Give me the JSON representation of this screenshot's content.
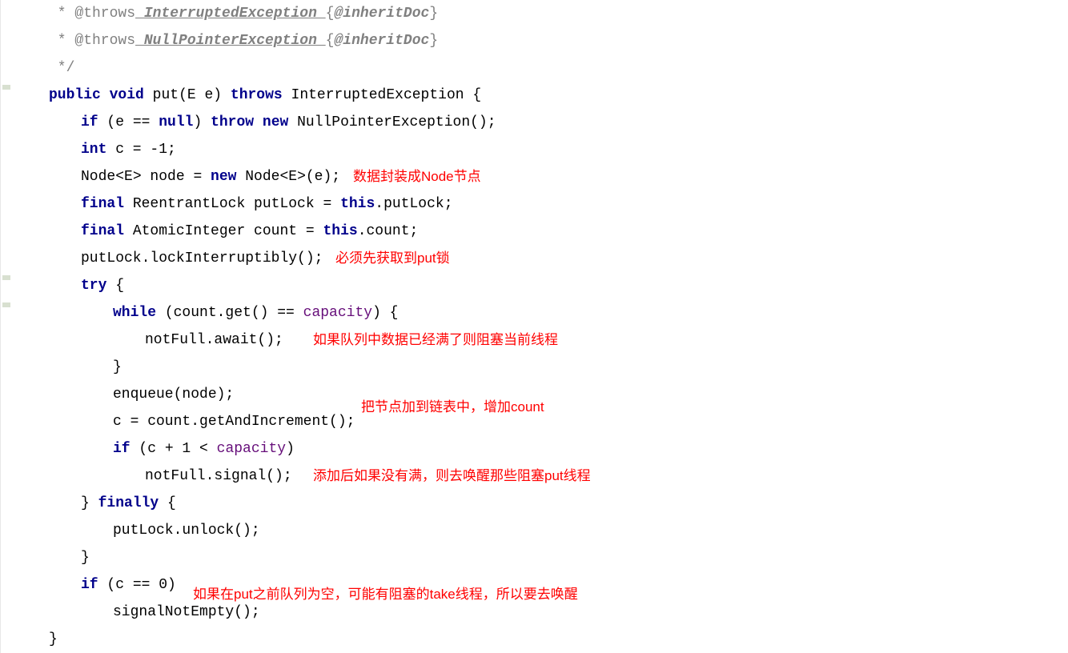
{
  "javadoc": {
    "throws1_tag": " * @throws",
    "throws1_ex": " InterruptedException ",
    "throws2_tag": " * @throws",
    "throws2_ex": " NullPointerException ",
    "inherit_open": "{",
    "inherit_tag": "@inheritDoc",
    "inherit_close": "}",
    "end": " */"
  },
  "kw": {
    "public": "public",
    "void": "void",
    "throws": "throws",
    "if": "if",
    "throw": "throw",
    "new": "new",
    "int": "int",
    "final": "final",
    "this": "this",
    "try": "try",
    "while": "while",
    "finally": "finally"
  },
  "code": {
    "methodName": " put",
    "paramType": "E",
    "paramName": " e",
    "throwsEx": " InterruptedException ",
    "nullCheck": " (e == ",
    "null": "null",
    "newNPE": " NullPointerException();",
    "intC": " c = -1;",
    "nodeDecl1": "Node<",
    "nodeDecl2": "> node = ",
    "nodeDecl3": " Node<",
    "nodeDecl4": ">(e);",
    "reentrant": " ReentrantLock putLock = ",
    "dotPutLock": ".putLock;",
    "atomic": " AtomicInteger count = ",
    "dotCount": ".count;",
    "lockInt": "putLock.lockInterruptibly();",
    "tryOpen": " {",
    "whileCond1": " (count.get() == ",
    "capacity": "capacity",
    "whileCond2": ") {",
    "notFullAwait": "notFull.await();",
    "closeBrace": "}",
    "enqueue": "enqueue(node);",
    "cGetInc": "c = count.getAndIncrement();",
    "ifCap1": " (c + 1 < ",
    "ifCap2": ")",
    "notFullSignal": "notFull.signal();",
    "finallyOpen": " {",
    "unlock": "putLock.unlock();",
    "ifCZero": " (c == 0)",
    "signalNotEmpty": "signalNotEmpty();"
  },
  "annotations": {
    "a1": "数据封装成Node节点",
    "a2": "必须先获取到put锁",
    "a3": "如果队列中数据已经满了则阻塞当前线程",
    "a4": "把节点加到链表中，增加count",
    "a5": "添加后如果没有满，则去唤醒那些阻塞put线程",
    "a6": "如果在put之前队列为空，可能有阻塞的take线程，所以要去唤醒"
  }
}
